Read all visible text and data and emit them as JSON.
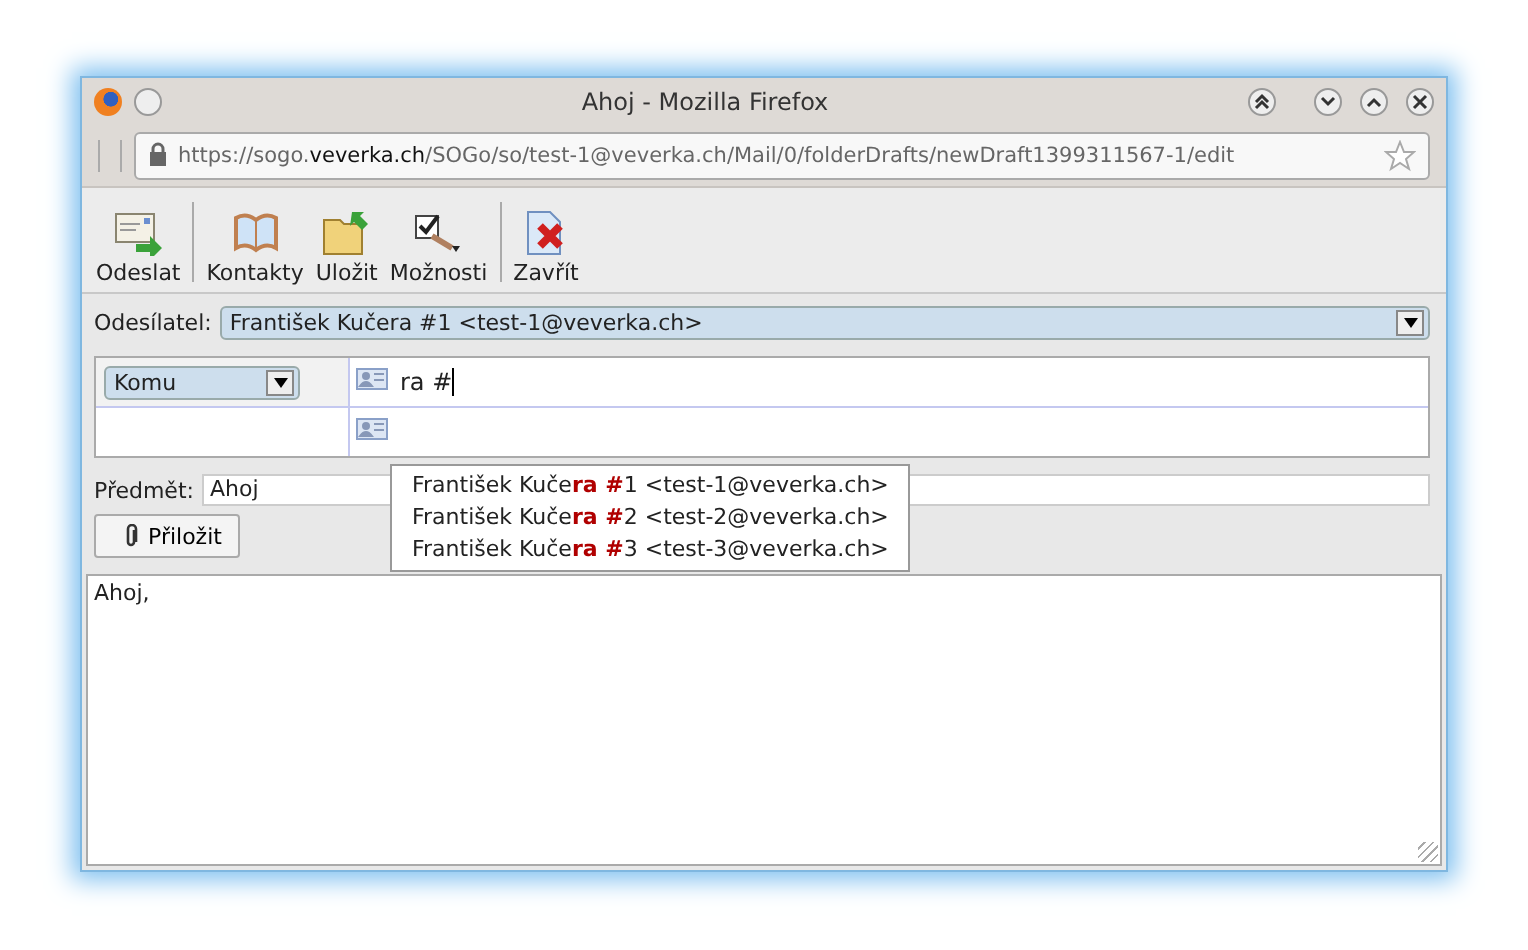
{
  "window": {
    "title": "Ahoj - Mozilla Firefox"
  },
  "address_bar": {
    "url": "https://sogo.**veverka.ch**/SOGo/so/test-1@veverka.ch/Mail/0/folderDrafts/newDraft1399311567-1/edit"
  },
  "toolbar": [
    {
      "label": "Odeslat",
      "kind": "send"
    },
    {
      "label": "Kontakty",
      "kind": "contacts"
    },
    {
      "label": "Uložit",
      "kind": "save"
    },
    {
      "label": "Možnosti",
      "kind": "options"
    },
    {
      "label": "Zavřít",
      "kind": "close"
    }
  ],
  "sender": {
    "label": "Odesílatel:",
    "value": "František Kučera #1 <test-1@veverka.ch>"
  },
  "recipients": [
    {
      "type": "Komu",
      "value": "ra #"
    }
  ],
  "autocomplete": [
    {
      "text": "František Kuče**ra #**1 <test-1@veverka.ch>"
    },
    {
      "text": "František Kuče**ra #**2 <test-2@veverka.ch>"
    },
    {
      "text": "František Kuče**ra #**3 <test-3@veverka.ch>"
    }
  ],
  "subject": {
    "label": "Předmět:",
    "value": "Ahoj"
  },
  "attach_button": "Přiložit",
  "body": "Ahoj,"
}
